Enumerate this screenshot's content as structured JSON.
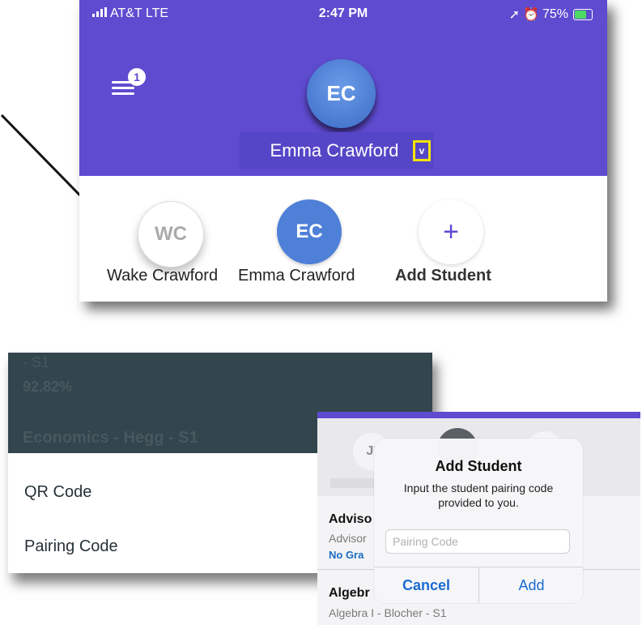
{
  "status_bar": {
    "carrier": "AT&T  LTE",
    "time": "2:47 PM",
    "battery": "75%"
  },
  "header": {
    "menu_badge": "1",
    "avatar_initials": "EC",
    "student_name": "Emma Crawford",
    "chevron": "v"
  },
  "students": [
    {
      "initials": "WC",
      "name": "Wake Crawford"
    },
    {
      "initials": "EC",
      "name": "Emma Crawford"
    },
    {
      "initials": "+",
      "name": "Add Student"
    }
  ],
  "sheet": {
    "dimmed": {
      "term": "- S1",
      "grade": "92.82%",
      "course": "Economics - Hegg - S1"
    },
    "options": [
      "QR Code",
      "Pairing Code"
    ]
  },
  "add_student_dialog": {
    "background": {
      "avatar_initials": "JI",
      "advisory_title": "Adviso",
      "advisory_sub": "Advisor",
      "advisory_grade": "No Gra",
      "algebra_title": "Algebr",
      "algebra_sub": "Algebra I - Blocher - S1"
    },
    "title": "Add Student",
    "message": "Input the student pairing code provided to you.",
    "input_placeholder": "Pairing Code",
    "cancel_label": "Cancel",
    "add_label": "Add"
  },
  "colors": {
    "header_purple": "#5e4bd0",
    "highlight_yellow": "#f4e300",
    "ios_blue": "#1a6bd1",
    "avatar_blue": "#4e80d8"
  }
}
